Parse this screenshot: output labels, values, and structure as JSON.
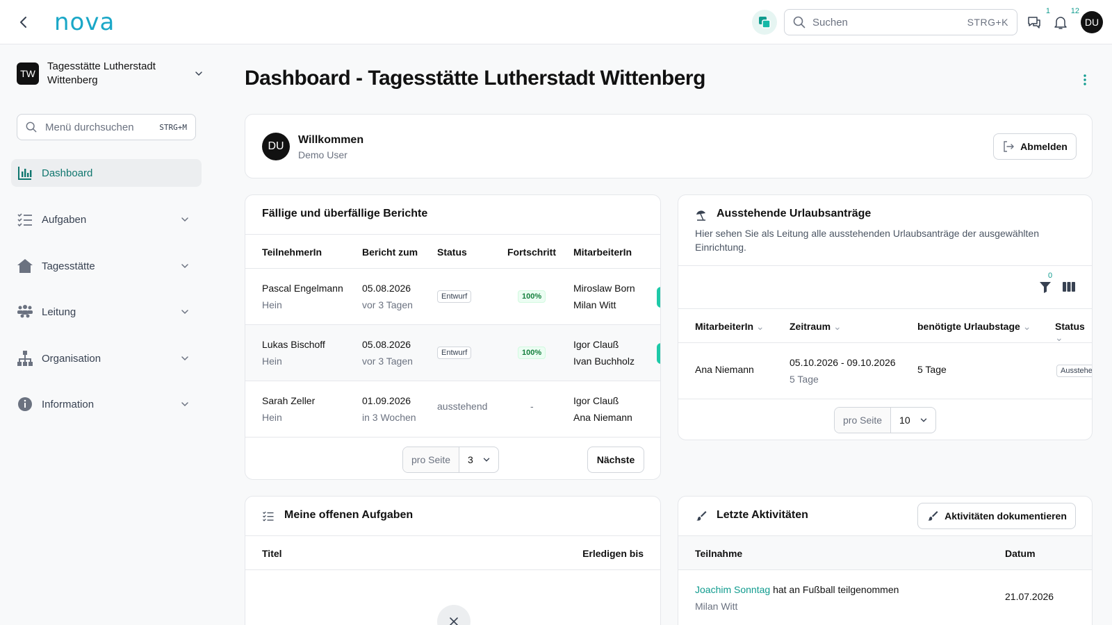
{
  "header": {
    "logo": "nova",
    "search_placeholder": "Suchen",
    "search_shortcut": "STRG+K",
    "messages_count": "1",
    "notifications_count": "12",
    "user_initials": "DU"
  },
  "sidebar": {
    "org_initials": "TW",
    "org_name": "Tagesstätte Lutherstadt Wittenberg",
    "search_placeholder": "Menü durchsuchen",
    "search_shortcut": "STRG+M",
    "items": [
      {
        "label": "Dashboard",
        "icon": "bar-chart-icon",
        "active": true
      },
      {
        "label": "Aufgaben",
        "icon": "checklist-icon"
      },
      {
        "label": "Tagesstätte",
        "icon": "home-icon"
      },
      {
        "label": "Leitung",
        "icon": "people-icon"
      },
      {
        "label": "Organisation",
        "icon": "org-chart-icon"
      },
      {
        "label": "Information",
        "icon": "info-icon"
      }
    ]
  },
  "main": {
    "title": "Dashboard - Tagesstätte Lutherstadt Wittenberg",
    "welcome": {
      "initials": "DU",
      "title": "Willkommen",
      "user": "Demo User",
      "logout_label": "Abmelden"
    },
    "reports": {
      "title": "Fällige und überfällige Berichte",
      "columns": [
        "TeilnehmerIn",
        "Bericht zum",
        "Status",
        "Fortschritt",
        "MitarbeiterIn"
      ],
      "rows": [
        {
          "name": "Pascal Engelmann",
          "sub": "Hein",
          "date": "05.08.2026",
          "rel": "vor 3 Tagen",
          "status": "Entwurf",
          "progress": "100%",
          "staff1": "Miroslaw Born",
          "staff2": "Milan Witt"
        },
        {
          "name": "Lukas Bischoff",
          "sub": "Hein",
          "date": "05.08.2026",
          "rel": "vor 3 Tagen",
          "status": "Entwurf",
          "progress": "100%",
          "staff1": "Igor Clauß",
          "staff2": "Ivan Buchholz"
        },
        {
          "name": "Sarah Zeller",
          "sub": "Hein",
          "date": "01.09.2026",
          "rel": "in 3 Wochen",
          "status": "ausstehend",
          "progress": "-",
          "staff1": "Igor Clauß",
          "staff2": "Ana Niemann"
        }
      ],
      "per_page_label": "pro Seite",
      "per_page_value": "3",
      "next_label": "Nächste"
    },
    "leave": {
      "title": "Ausstehende Urlaubsanträge",
      "description": "Hier sehen Sie als Leitung alle ausstehenden Urlaubsanträge der ausgewählten Einrichtung.",
      "filter_count": "0",
      "columns": [
        "MitarbeiterIn",
        "Zeitraum",
        "benötigte Urlaubstage",
        "Status"
      ],
      "rows": [
        {
          "name": "Ana Niemann",
          "period": "05.10.2026 - 09.10.2026",
          "period_sub": "5 Tage",
          "days": "5 Tage",
          "status": "Ausstehe"
        }
      ],
      "per_page_label": "pro Seite",
      "per_page_value": "10"
    },
    "tasks": {
      "title": "Meine offenen Aufgaben",
      "columns": [
        "Titel",
        "Erledigen bis"
      ]
    },
    "activities": {
      "title": "Letzte Aktivitäten",
      "document_label": "Aktivitäten dokumentieren",
      "columns": [
        "Teilnahme",
        "Datum"
      ],
      "rows": [
        {
          "person": "Joachim Sonntag",
          "text": "hat an Fußball teilgenommen",
          "staff": "Milan Witt",
          "date": "21.07.2026"
        }
      ]
    }
  },
  "colors": {
    "accent": "#0f9b8e",
    "logo": "#1aa7c7",
    "progress_green": "#15803d"
  }
}
